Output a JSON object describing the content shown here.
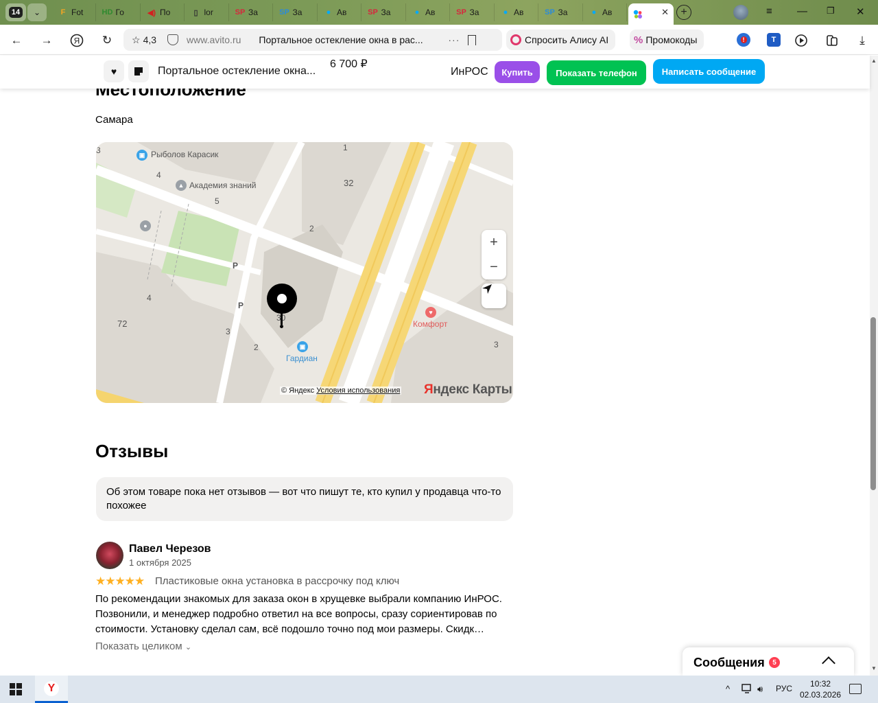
{
  "browser": {
    "tab_count": "14",
    "tabs": [
      {
        "icon": "F",
        "label": "Fot",
        "color": "#f5a623"
      },
      {
        "icon": "HD",
        "label": "Го",
        "color": "#2f8a2f"
      },
      {
        "icon": "◀)",
        "label": "По",
        "color": "#d32020"
      },
      {
        "icon": "▯",
        "label": "lor",
        "color": "#333333"
      },
      {
        "icon": "SP",
        "label": "За",
        "color": "#d7263d"
      },
      {
        "icon": "SP",
        "label": "За",
        "color": "#2b8bd8"
      },
      {
        "icon": "●",
        "label": "Ав",
        "color": "#00aaff"
      },
      {
        "icon": "SP",
        "label": "За",
        "color": "#d7263d"
      },
      {
        "icon": "●",
        "label": "Ав",
        "color": "#00aaff"
      },
      {
        "icon": "SP",
        "label": "За",
        "color": "#d7263d"
      },
      {
        "icon": "●",
        "label": "Ав",
        "color": "#00aaff"
      },
      {
        "icon": "SP",
        "label": "За",
        "color": "#2b8bd8"
      },
      {
        "icon": "●",
        "label": "Ав",
        "color": "#00aaff"
      }
    ],
    "active_tab_icon": "avito-logo-icon",
    "rating": "4,3",
    "domain": "www.avito.ru",
    "page_title": "Портальное остекление окна в рас...",
    "alice_label": "Спросить Алису AI",
    "promo_label": "Промокоды"
  },
  "sticky": {
    "title": "Портальное остекление окна...",
    "price": "6 700 ₽",
    "seller": "ИнРОС",
    "buy_label": "Купить",
    "phone_label": "Показать телефон",
    "message_label": "Написать сообщение"
  },
  "location": {
    "heading": "Местоположение",
    "city": "Самара"
  },
  "map": {
    "labels": {
      "fisher": "Рыболов Карасик",
      "academy": "Академия знаний",
      "comfort": "Комфорт",
      "guardian": "Гардиан",
      "house32": "32",
      "house72": "72",
      "house30": "30",
      "e1": "1",
      "e4a": "4",
      "e5": "5",
      "e2a": "2",
      "e4b": "4",
      "e3a": "3",
      "e2b": "2",
      "e3b": "3",
      "e3c": "3",
      "parking1": "P",
      "parking2": "P"
    },
    "zoom_in": "+",
    "zoom_out": "−",
    "copyright": "© Яндекс",
    "terms": "Условия использования",
    "logo_y": "Я",
    "logo_rest": "ндекс Карты"
  },
  "reviews": {
    "heading": "Отзывы",
    "note": "Об этом товаре пока нет отзывов — вот что пишут те, кто купил у продавца что-то похожее",
    "items": [
      {
        "author": "Павел Черезов",
        "date": "1 октября 2025",
        "stars": "★★★★★",
        "rating": 5,
        "subject": "Пластиковые окна установка в рассрочку под ключ",
        "text": "По рекомендации знакомых для заказа окон в хрущевке выбрали компанию ИнРОС. Позвонили, и менеджер подробно ответил на все вопросы, сразу сориентировав по стоимости. Установку сделал сам, всё подошло точно под мои размеры. Скидк…",
        "more": "Показать целиком"
      }
    ]
  },
  "messages": {
    "label": "Сообщения",
    "count": "5"
  },
  "taskbar": {
    "lang": "РУС",
    "time": "10:32",
    "date": "02.03.2026"
  }
}
